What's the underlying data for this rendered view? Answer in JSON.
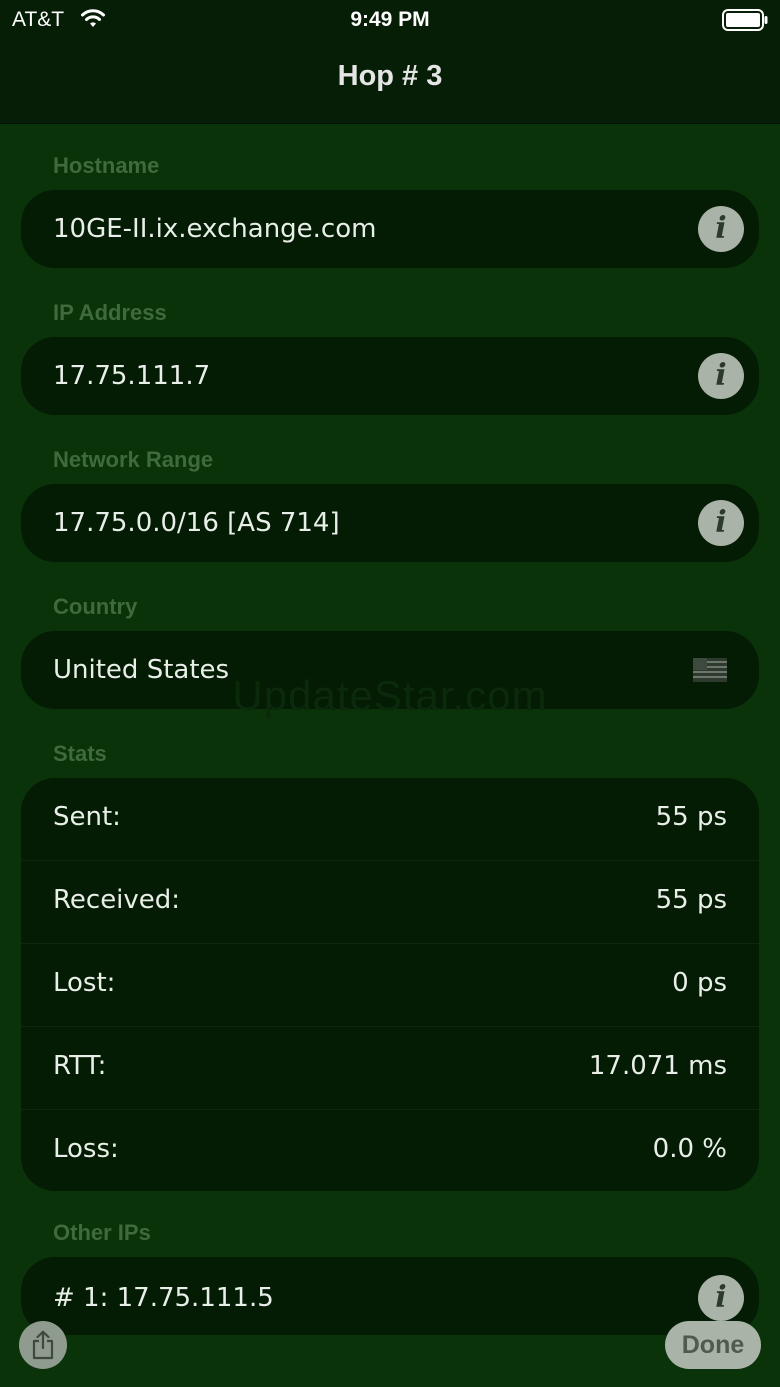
{
  "status_bar": {
    "carrier": "AT&T",
    "time": "9:49 PM"
  },
  "nav": {
    "title": "Hop # 3"
  },
  "sections": {
    "hostname": {
      "header": "Hostname",
      "value": "10GE-II.ix.exchange.com"
    },
    "ip": {
      "header": "IP Address",
      "value": "17.75.111.7"
    },
    "range": {
      "header": "Network Range",
      "value": "17.75.0.0/16 [AS 714]"
    },
    "country": {
      "header": "Country",
      "value": "United States"
    },
    "stats": {
      "header": "Stats",
      "rows": [
        {
          "label": "Sent:",
          "value": "55 ps"
        },
        {
          "label": "Received:",
          "value": "55 ps"
        },
        {
          "label": "Lost:",
          "value": "0 ps"
        },
        {
          "label": "RTT:",
          "value": "17.071 ms"
        },
        {
          "label": "Loss:",
          "value": "0.0 %"
        }
      ]
    },
    "other_ips": {
      "header": "Other IPs",
      "items": [
        "# 1: 17.75.111.5"
      ]
    }
  },
  "watermark": "UpdateStar.com",
  "toolbar": {
    "done_label": "Done"
  },
  "icons": {
    "info": "info-icon",
    "flag": "us-flag-icon",
    "share": "share-icon"
  },
  "colors": {
    "background": "#0a3309",
    "card": "#041b04",
    "section_header": "#3f6a3d",
    "button": "#a9b3a8"
  }
}
